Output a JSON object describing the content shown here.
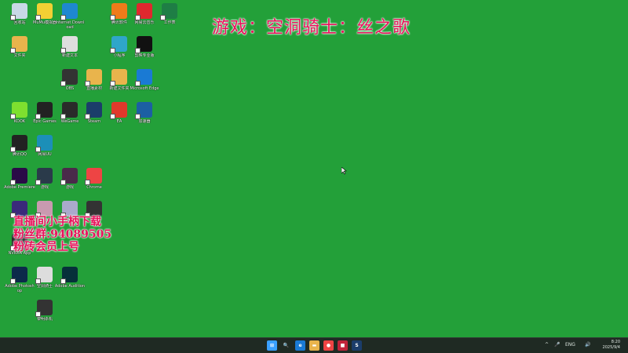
{
  "overlay": {
    "game_title": "游戏：空洞骑士：丝之歌",
    "promo_lines": [
      "直播间小手柄下载",
      "粉丝群:94089505",
      "粉砖会员上号"
    ]
  },
  "desktop_icons": [
    {
      "name": "recycle-bin-icon",
      "label": "回收站",
      "color": "#c8d8e6"
    },
    {
      "name": "app-icon",
      "label": "MuMu模拟器",
      "color": "#f2d034"
    },
    {
      "name": "edge-download-icon",
      "label": "Internet Download",
      "color": "#1e88d0"
    },
    {
      "name": "software-icon",
      "label": "腾讯软件",
      "color": "#ef7b1a"
    },
    {
      "name": "netease-music-icon",
      "label": "网易云音乐",
      "color": "#e0282e"
    },
    {
      "name": "excel-icon",
      "label": "工作表",
      "color": "#1e7e45"
    },
    {
      "name": "folder-icon",
      "label": "文件夹",
      "color": "#e9b44c"
    },
    {
      "name": "file-icon",
      "label": "新建文本",
      "color": "#dedede"
    },
    {
      "name": "app-icon",
      "label": "小程序",
      "color": "#2fa6c9"
    },
    {
      "name": "capcut-icon",
      "label": "剪映专业版",
      "color": "#111"
    },
    {
      "name": "screen-icon",
      "label": "OBS",
      "color": "#333"
    },
    {
      "name": "folder-icon",
      "label": "直播素材",
      "color": "#e9b44c"
    },
    {
      "name": "folder-icon",
      "label": "新建文件夹",
      "color": "#e9b44c"
    },
    {
      "name": "edge-icon",
      "label": "Microsoft Edge",
      "color": "#1a7ad4"
    },
    {
      "name": "kook-icon",
      "label": "KOOK",
      "color": "#7ee02f"
    },
    {
      "name": "epic-icon",
      "label": "Epic Games",
      "color": "#222"
    },
    {
      "name": "wegame-icon",
      "label": "WeGame",
      "color": "#2a2a2a"
    },
    {
      "name": "steam-icon",
      "label": "Steam",
      "color": "#1b3d6a"
    },
    {
      "name": "ea-icon",
      "label": "EA",
      "color": "#e0392b"
    },
    {
      "name": "app-icon",
      "label": "加速器",
      "color": "#1c5fa3"
    },
    {
      "name": "qq-icon",
      "label": "腾讯QQ",
      "color": "#222"
    },
    {
      "name": "app-icon",
      "label": "网易UU",
      "color": "#1c8fb8"
    },
    {
      "name": "premiere-icon",
      "label": "Adobe Premiere",
      "color": "#2a0b47"
    },
    {
      "name": "game-icon",
      "label": "游戏",
      "color": "#2a3a4a"
    },
    {
      "name": "game-icon",
      "label": "游戏",
      "color": "#4a2a4a"
    },
    {
      "name": "chrome-icon",
      "label": "Chrome",
      "color": "#e44"
    },
    {
      "name": "app-icon",
      "label": "应用",
      "color": "#3a2a7a"
    },
    {
      "name": "game-icon",
      "label": "游戏",
      "color": "#c99ab0"
    },
    {
      "name": "game-icon",
      "label": "游戏",
      "color": "#aac"
    },
    {
      "name": "app-icon",
      "label": "程序",
      "color": "#333"
    },
    {
      "name": "nvidia-icon",
      "label": "NVIDIA App",
      "color": "#2b2b2b"
    },
    {
      "name": "photoshop-icon",
      "label": "Adobe Photoshop",
      "color": "#0c2a4a"
    },
    {
      "name": "game-icon",
      "label": "空洞骑士",
      "color": "#ddd"
    },
    {
      "name": "audition-icon",
      "label": "Adobe Audition",
      "color": "#06303a"
    },
    {
      "name": "game-icon",
      "label": "黎明杀机",
      "color": "#333"
    }
  ],
  "taskbar": {
    "apps": [
      {
        "name": "start-button",
        "glyph": "⊞",
        "color": "#3aa0ff"
      },
      {
        "name": "search-icon",
        "glyph": "🔍",
        "color": "#1f2a23"
      },
      {
        "name": "edge-icon",
        "glyph": "e",
        "color": "#1a7ad4"
      },
      {
        "name": "file-explorer-icon",
        "glyph": "▬",
        "color": "#e9b44c"
      },
      {
        "name": "chrome-icon",
        "glyph": "●",
        "color": "#e44"
      },
      {
        "name": "app-icon",
        "glyph": "■",
        "color": "#c0233a"
      },
      {
        "name": "steam-icon",
        "glyph": "S",
        "color": "#1b3d6a"
      }
    ],
    "tray": {
      "caret": "^",
      "mic": "🎤",
      "lang": "ENG",
      "speaker": "🔊"
    },
    "clock": {
      "time": "8:20",
      "date": "2025/9/4"
    }
  }
}
